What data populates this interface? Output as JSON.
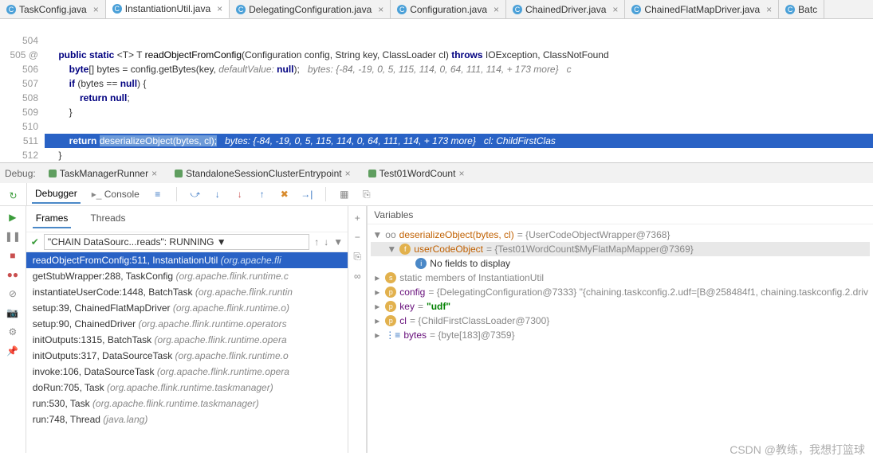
{
  "tabs": [
    {
      "label": "TaskConfig.java",
      "active": false
    },
    {
      "label": "InstantiationUtil.java",
      "active": true
    },
    {
      "label": "DelegatingConfiguration.java",
      "active": false
    },
    {
      "label": "Configuration.java",
      "active": false
    },
    {
      "label": "ChainedDriver.java",
      "active": false
    },
    {
      "label": "ChainedFlatMapDriver.java",
      "active": false
    },
    {
      "label": "Batc",
      "active": false
    }
  ],
  "gutter": [
    "",
    "504",
    "505   @",
    "506",
    "507",
    "508",
    "509",
    "510",
    "511",
    "512"
  ],
  "code": {
    "l504": "",
    "l505_pre": "    public static <T> T ",
    "l505_meth": "readObjectFromConfig",
    "l505_post": "(Configuration config, String key, ClassLoader cl) throws IOException, ClassNotFound",
    "l506": "        byte[] bytes = config.getBytes(key, ",
    "l506_hint": "defaultValue: ",
    "l506_null": "null",
    "l506_end": ");   ",
    "l506_com": "bytes: {-84, -19, 0, 5, 115, 114, 0, 64, 111, 114, + 173 more}   c",
    "l507": "        if (bytes == null) {",
    "l508": "            return null;",
    "l509": "        }",
    "l510": "",
    "l511_pre": "        return ",
    "l511_sel": "deserializeObject(bytes, cl);",
    "l511_com": "   bytes: {-84, -19, 0, 5, 115, 114, 0, 64, 111, 114, + 173 more}   cl: ChildFirstClas",
    "l512": "    }"
  },
  "debug": {
    "label": "Debug:",
    "runConfigs": [
      "TaskManagerRunner",
      "StandaloneSessionClusterEntrypoint",
      "Test01WordCount"
    ]
  },
  "panel": {
    "debugger": "Debugger",
    "console": "Console",
    "frames": "Frames",
    "threads": "Threads",
    "variables": "Variables",
    "threadSelect": "\"CHAIN DataSourc...reads\": RUNNING"
  },
  "frames": [
    {
      "text": "readObjectFromConfig:511, InstantiationUtil",
      "pkg": "(org.apache.fli",
      "sel": true
    },
    {
      "text": "getStubWrapper:288, TaskConfig",
      "pkg": "(org.apache.flink.runtime.c"
    },
    {
      "text": "instantiateUserCode:1448, BatchTask",
      "pkg": "(org.apache.flink.runtin"
    },
    {
      "text": "setup:39, ChainedFlatMapDriver",
      "pkg": "(org.apache.flink.runtime.o)"
    },
    {
      "text": "setup:90, ChainedDriver",
      "pkg": "(org.apache.flink.runtime.operators"
    },
    {
      "text": "initOutputs:1315, BatchTask",
      "pkg": "(org.apache.flink.runtime.opera"
    },
    {
      "text": "initOutputs:317, DataSourceTask",
      "pkg": "(org.apache.flink.runtime.o"
    },
    {
      "text": "invoke:106, DataSourceTask",
      "pkg": "(org.apache.flink.runtime.opera"
    },
    {
      "text": "doRun:705, Task",
      "pkg": "(org.apache.flink.runtime.taskmanager)"
    },
    {
      "text": "run:530, Task",
      "pkg": "(org.apache.flink.runtime.taskmanager)"
    },
    {
      "text": "run:748, Thread",
      "pkg": "(java.lang)"
    }
  ],
  "vars": {
    "root": "deserializeObject(bytes, cl)",
    "rootVal": " = {UserCodeObjectWrapper@7368}",
    "userCode": "userCodeObject",
    "userCodeVal": " = {Test01WordCount$MyFlatMapMapper@7369}",
    "noFields": "No fields to display",
    "static": "static",
    "staticVal": " members of InstantiationUtil",
    "config": "config",
    "configVal": " = {DelegatingConfiguration@7333} \"{chaining.taskconfig.2.udf=[B@258484f1, chaining.taskconfig.2.driv",
    "key": "key",
    "keyVal": " = ",
    "keyStr": "\"udf\"",
    "cl": "cl",
    "clVal": " = {ChildFirstClassLoader@7300}",
    "bytes": "bytes",
    "bytesVal": " = {byte[183]@7359}"
  },
  "watermark": "CSDN @教练，我想打篮球"
}
